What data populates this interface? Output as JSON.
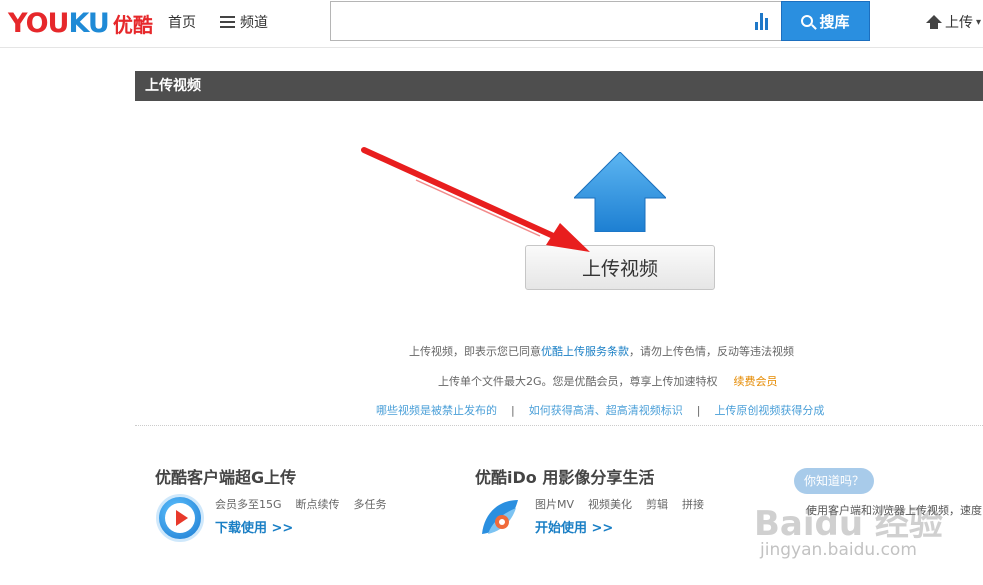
{
  "header": {
    "logo_latin_a": "YOU",
    "logo_latin_b": "KU",
    "logo_cn": "优酷",
    "nav_home": "首页",
    "nav_channel": "频道",
    "search_value": "",
    "search_button": "搜库",
    "upload_label": "上传"
  },
  "section": {
    "title": "上传视频"
  },
  "upload": {
    "button_label": "上传视频"
  },
  "notes": {
    "agree_prefix": "上传视频，即表示您已同意",
    "agree_link": "优酷上传服务条款",
    "agree_suffix": "，请勿上传色情，反动等违法视频",
    "size_text": "上传单个文件最大2G。您是优酷会员，尊享上传加速特权",
    "vip_link": "续费会员"
  },
  "links": [
    "哪些视频是被禁止发布的",
    "如何获得高清、超高清视频标识",
    "上传原创视频获得分成"
  ],
  "link_separator": "|",
  "promos": {
    "client": {
      "title": "优酷客户端超G上传",
      "features": [
        "会员多至15G",
        "断点续传",
        "多任务"
      ],
      "link": "下载使用 >>"
    },
    "ido": {
      "title": "优酷iDo 用影像分享生活",
      "features": [
        "图片MV",
        "视频美化",
        "剪辑",
        "拼接"
      ],
      "link": "开始使用 >>"
    }
  },
  "tips": {
    "bubble": "你知道吗？",
    "text": "使用客户端和浏览器上传视频，速度"
  },
  "watermark": {
    "logo": "Baidu 经验",
    "url": "jingyan.baidu.com"
  },
  "colors": {
    "brand_red": "#e6282b",
    "brand_blue": "#1f8ad6",
    "search_button": "#2a8fe0",
    "section_bar": "#4e4e4e",
    "link_blue": "#1a7fc5",
    "vip_orange": "#e58a00",
    "annotation_arrow": "#e81e1e"
  },
  "icons": {
    "menu": "hamburger-icon",
    "stats": "bar-chart-icon",
    "search": "magnifier-icon",
    "upload": "upload-arrow-icon",
    "big_upload": "big-upload-arrow-icon",
    "client": "youku-client-play-icon",
    "ido": "ido-app-icon"
  }
}
